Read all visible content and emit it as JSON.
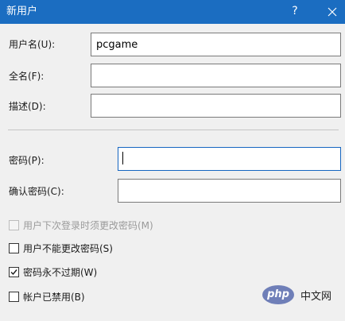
{
  "window": {
    "title": "新用户",
    "help_label": "?"
  },
  "fields": [
    {
      "label": "用户名(U):",
      "value": "pcgame"
    },
    {
      "label": "全名(F):",
      "value": ""
    },
    {
      "label": "描述(D):",
      "value": ""
    },
    {
      "label": "密码(P):",
      "value": ""
    },
    {
      "label": "确认密码(C):",
      "value": ""
    }
  ],
  "checkboxes": [
    {
      "label": "用户下次登录时须更改密码(M)",
      "checked": false,
      "disabled": true
    },
    {
      "label": "用户不能更改密码(S)",
      "checked": false,
      "disabled": false
    },
    {
      "label": "密码永不过期(W)",
      "checked": true,
      "disabled": false
    },
    {
      "label": "帐户已禁用(B)",
      "checked": false,
      "disabled": false
    }
  ],
  "watermark": {
    "logo_text": "php",
    "site_text": "中文网"
  },
  "colors": {
    "titlebar": "#1b6dc1",
    "focus_border": "#1565c0"
  },
  "icons": {
    "close": "close-icon",
    "check": "checkmark-icon"
  }
}
